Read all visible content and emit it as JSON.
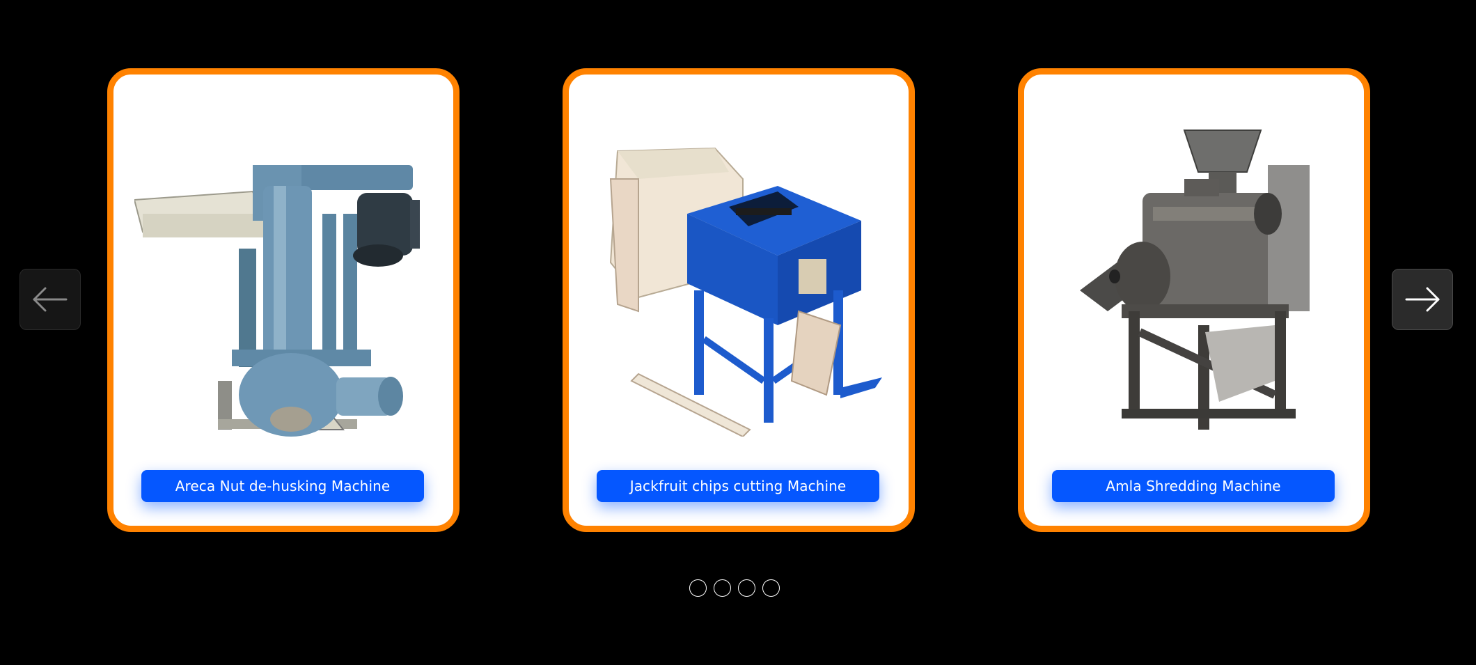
{
  "carousel": {
    "items": [
      {
        "label": "Areca Nut de-husking Machine",
        "image": "areca-nut-dehusking-machine-photo"
      },
      {
        "label": "Jackfruit chips cutting Machine",
        "image": "jackfruit-chips-cutting-machine-photo"
      },
      {
        "label": "Amla Shredding Machine",
        "image": "amla-shredding-machine-photo"
      }
    ],
    "prev_icon": "arrow-left-icon",
    "next_icon": "arrow-right-icon",
    "dot_count": 4
  },
  "colors": {
    "background": "#000000",
    "card_border": "#ff8200",
    "card_background": "#ffffff",
    "label_background": "#0557ff",
    "label_text": "#ffffff",
    "arrow_prev_bg": "#161616",
    "arrow_next_bg": "#2b2b2b"
  }
}
